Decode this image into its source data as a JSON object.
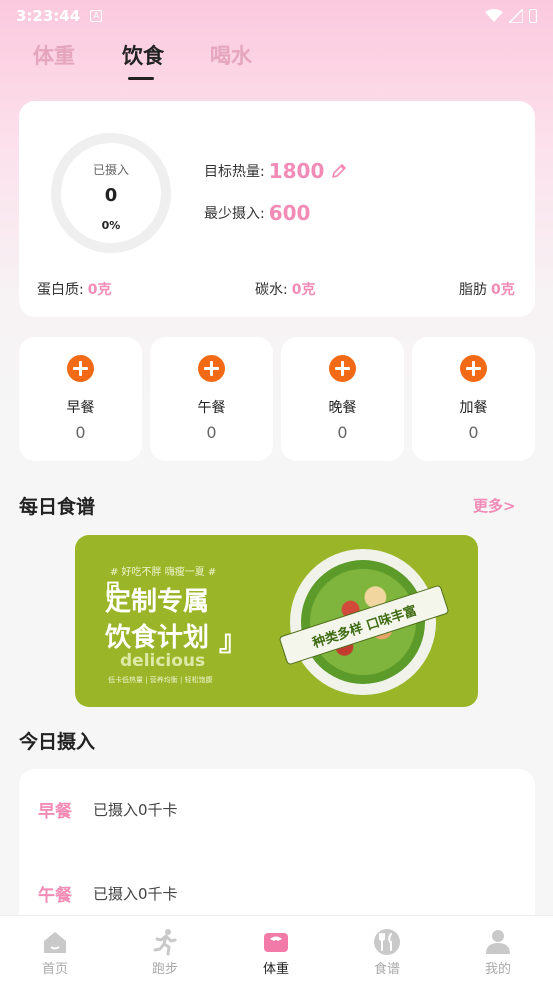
{
  "status_bar": {
    "time": "3:23:44",
    "notif_glyph": "A"
  },
  "tabs": [
    {
      "label": "体重",
      "active": false
    },
    {
      "label": "饮食",
      "active": true
    },
    {
      "label": "喝水",
      "active": false
    }
  ],
  "summary": {
    "ring_label": "已摄入",
    "ring_value": "0",
    "ring_percent": "0%",
    "progress_fraction": 0,
    "target_label": "目标热量:",
    "target_value": "1800",
    "min_label": "最少摄入:",
    "min_value": "600",
    "macros": [
      {
        "label": "蛋白质:",
        "value": "0克"
      },
      {
        "label": "碳水:",
        "value": "0克"
      },
      {
        "label": "脂肪",
        "value": "0克"
      }
    ]
  },
  "meals": [
    {
      "name": "早餐",
      "count": "0"
    },
    {
      "name": "午餐",
      "count": "0"
    },
    {
      "name": "晚餐",
      "count": "0"
    },
    {
      "name": "加餐",
      "count": "0"
    }
  ],
  "daily_recipe": {
    "title": "每日食谱",
    "more": "更多>",
    "banner": {
      "tagline": "# 好吃不胖  嗨瘦一夏 #",
      "line1": "定制专属",
      "line2": "饮食计划",
      "delicious": "delicious",
      "small": "低卡低热量 | 营养均衡 | 轻松饱腹",
      "ribbon": "种类多样 口味丰富"
    }
  },
  "today_intake": {
    "title": "今日摄入",
    "rows": [
      {
        "meal": "早餐",
        "value": "已摄入0千卡"
      },
      {
        "meal": "午餐",
        "value": "已摄入0千卡"
      }
    ]
  },
  "bottom_nav": [
    {
      "label": "首页",
      "icon": "home-icon",
      "active": false
    },
    {
      "label": "跑步",
      "icon": "running-icon",
      "active": false
    },
    {
      "label": "体重",
      "icon": "scale-icon",
      "active": true
    },
    {
      "label": "食谱",
      "icon": "cutlery-icon",
      "active": false
    },
    {
      "label": "我的",
      "icon": "profile-icon",
      "active": false
    }
  ],
  "colors": {
    "accent_pink": "#f28bb6",
    "plus_orange": "#f26a15",
    "banner_green": "#9ab628"
  }
}
